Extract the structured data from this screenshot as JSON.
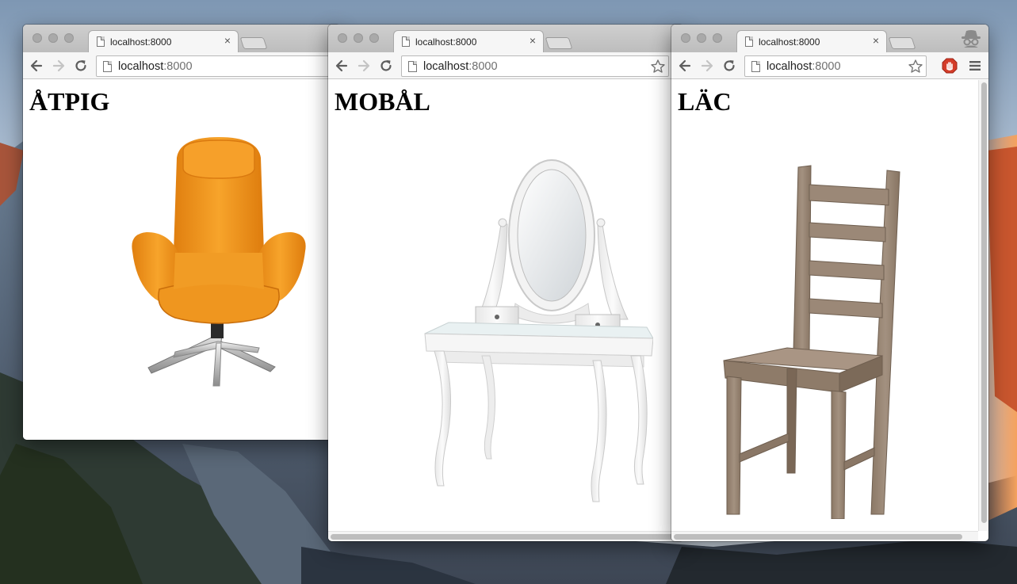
{
  "windows": [
    {
      "tab_title": "localhost:8000",
      "url_host": "localhost",
      "url_port": ":8000",
      "heading": "ÅTPIG",
      "product_image": "orange-swivel-armchair"
    },
    {
      "tab_title": "localhost:8000",
      "url_host": "localhost",
      "url_port": ":8000",
      "heading": "MOBÅL",
      "product_image": "white-dressing-table-with-mirror"
    },
    {
      "tab_title": "localhost:8000",
      "url_host": "localhost",
      "url_port": ":8000",
      "heading": "LÄC",
      "product_image": "grey-brown-wooden-chair"
    }
  ],
  "icons": {
    "tab_close": "×",
    "extension": "adblock-stop-icon",
    "incognito": "incognito-spy-icon"
  },
  "colors": {
    "armchair_orange": "#f39b22",
    "dressing_table_white": "#f2f2f2",
    "chair_taupe": "#9a8876",
    "adblock_red": "#d43c29"
  }
}
